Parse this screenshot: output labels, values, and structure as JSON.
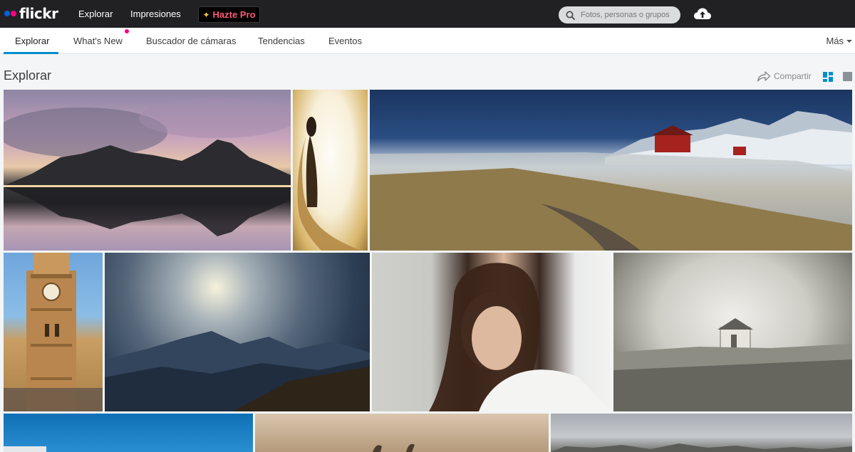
{
  "brand": {
    "logo_text": "flickr",
    "dot_colors": [
      "#0063dc",
      "#ff0084"
    ]
  },
  "topnav": {
    "links": [
      "Explorar",
      "Impresiones"
    ],
    "pro_button": "Hazte Pro",
    "search_placeholder": "Fotos, personas o grupos",
    "upload_icon": "cloud-upload-icon"
  },
  "subnav": {
    "tabs": [
      "Explorar",
      "What's New",
      "Buscador de cámaras",
      "Tendencias",
      "Eventos"
    ],
    "active_tab": "Explorar",
    "more_label": "Más",
    "accent": "#008ecc",
    "notification_dot_color": "#ff0084"
  },
  "page": {
    "title": "Explorar",
    "share_label": "Compartir",
    "view_modes": [
      "grid-view-icon",
      "single-view-icon"
    ]
  },
  "photos": [
    "mountain-reflection-sunset",
    "woman-in-golden-dress",
    "red-house-snowy-coast",
    "stone-clock-tower",
    "sun-over-mountain-valley",
    "woman-reading-portrait",
    "house-in-misty-field",
    "blue-sky",
    "animal-horns",
    "cloudy-landscape"
  ]
}
